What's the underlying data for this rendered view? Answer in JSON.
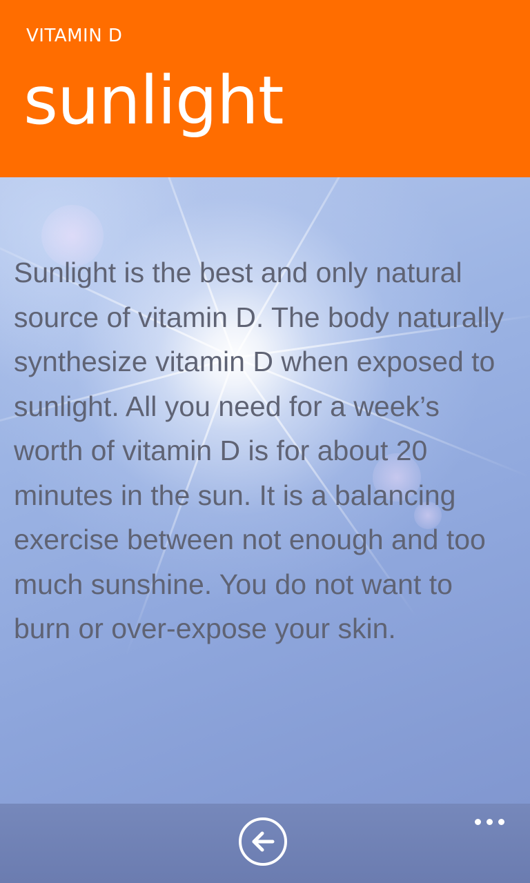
{
  "header": {
    "app_title": "VITAMIN D",
    "page_title": "sunlight"
  },
  "content": {
    "text": "Sunlight is the best and only natural source of vitamin D. The body naturally synthesize vitamin D when exposed to sunlight. All you need for a week’s worth of vitamin D is for about 20 minutes in the sun. It is a balancing exercise between not enough and too much sunshine. You do not want to burn or over-expose your skin."
  },
  "app_bar": {
    "back_icon": "back-arrow-icon",
    "more_icon": "ellipsis-icon"
  },
  "colors": {
    "accent": "#ff6d00",
    "header_text": "#ffffff",
    "body_text": "#5f6374",
    "app_bar": "#6b7cb0"
  }
}
